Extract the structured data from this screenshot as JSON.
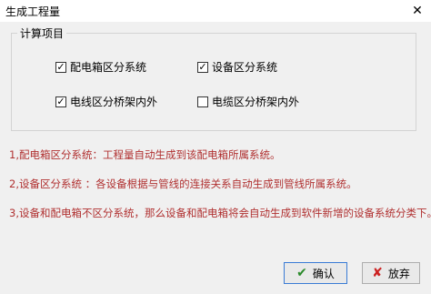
{
  "window": {
    "title": "生成工程量"
  },
  "group": {
    "legend": "计算项目"
  },
  "checkboxes": [
    {
      "label": "配电箱区分系统",
      "checked": true
    },
    {
      "label": "设备区分系统",
      "checked": true
    },
    {
      "label": "电线区分桥架内外",
      "checked": true
    },
    {
      "label": "电缆区分桥架内外",
      "checked": false
    }
  ],
  "notes": [
    "1,配电箱区分系统：工程量自动生成到该配电箱所属系统。",
    "2,设备区分系统 ：各设备根据与管线的连接关系自动生成到管线所属系统。",
    "3,设备和配电箱不区分系统，那么设备和配电箱将会自动生成到软件新增的设备系统分类下。"
  ],
  "buttons": {
    "ok": "确认",
    "cancel": "放弃"
  }
}
